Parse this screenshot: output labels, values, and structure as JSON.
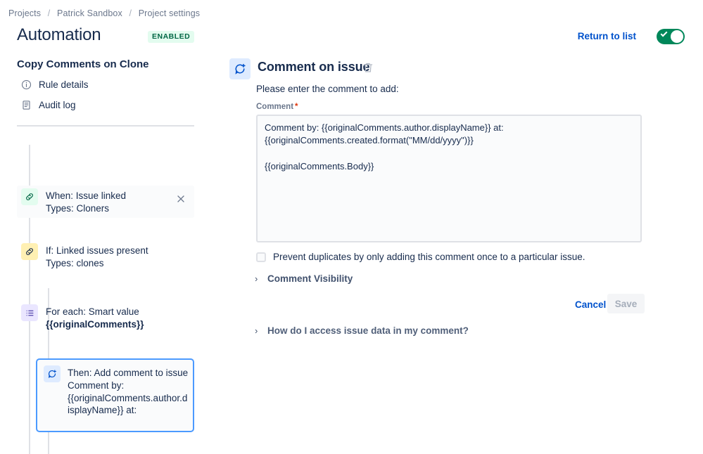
{
  "breadcrumb": {
    "items": [
      "Projects",
      "Patrick Sandbox",
      "Project settings"
    ],
    "separator": "/"
  },
  "header": {
    "title": "Automation",
    "status_badge": "ENABLED",
    "return_link": "Return to list",
    "toggle_state": "on",
    "toggle_color": "#00875a",
    "badge_bg": "#e3fcef",
    "badge_color": "#006644",
    "link_color": "#0052cc"
  },
  "rule_panel": {
    "rule_name": "Copy Comments on Clone",
    "nav": [
      {
        "label": "Rule details",
        "icon": "info-circle-icon"
      },
      {
        "label": "Audit log",
        "icon": "document-icon"
      }
    ],
    "tree": [
      {
        "title": "When: Issue linked",
        "subtitle": "Types: Cloners",
        "icon": "link-icon",
        "badge_bg": "#e3fcef",
        "badge_color": "#006644",
        "selected": false,
        "has_close": true
      },
      {
        "title": "If: Linked issues present",
        "subtitle": "Types: clones",
        "icon": "link-icon",
        "badge_bg": "#fff0b3",
        "badge_color": "#172b4d",
        "selected": false,
        "has_close": false
      },
      {
        "title": "For each: Smart value",
        "subtitle": "{{originalComments}}",
        "subtitle_bold": true,
        "icon": "list-icon",
        "badge_bg": "#eae6ff",
        "badge_color": "#5243aa",
        "selected": false,
        "has_close": false
      },
      {
        "title": "Then: Add comment to issue",
        "subtitle": "Comment by: {{originalComments.author.displayName}} at:",
        "icon": "comment-add-icon",
        "badge_bg": "#deebff",
        "badge_color": "#0052cc",
        "selected": true,
        "has_close": false,
        "selected_border_color": "#4c9aff"
      }
    ]
  },
  "detail_panel": {
    "icon": "comment-add-icon",
    "title": "Comment on issue",
    "delete_icon": "trash-icon",
    "instruction": "Please enter the comment to add:",
    "comment_label": "Comment",
    "comment_required_marker": "*",
    "comment_value": "Comment by: {{originalComments.author.displayName}} at: {{originalComments.created.format(\"MM/dd/yyyy\")}}\n\n{{originalComments.Body}}",
    "prevent_duplicates_label": "Prevent duplicates by only adding this comment once to a particular issue.",
    "prevent_duplicates_checked": false,
    "comment_visibility_label": "Comment Visibility",
    "comment_visibility_expanded": false,
    "cancel_label": "Cancel",
    "save_label": "Save",
    "save_enabled": false,
    "help_label": "How do I access issue data in my comment?",
    "help_expanded": false
  }
}
